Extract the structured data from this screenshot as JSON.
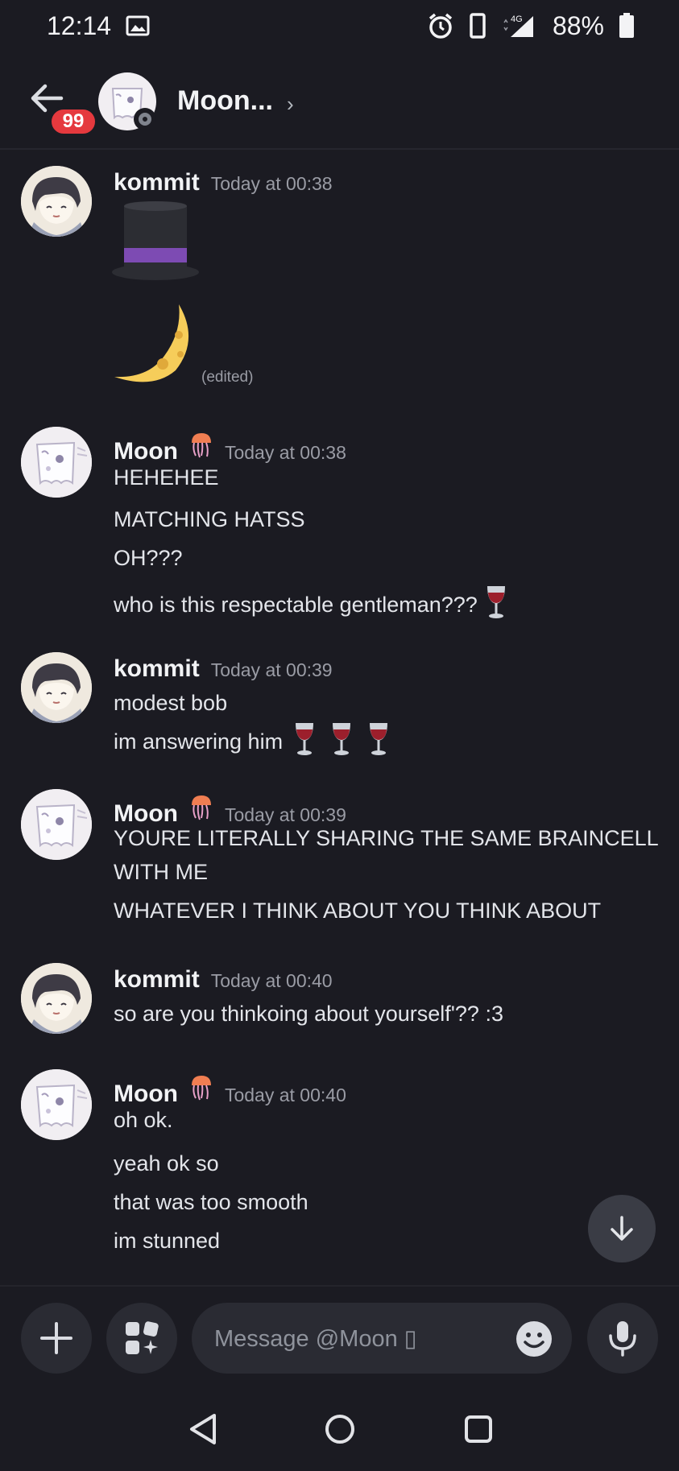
{
  "status_bar": {
    "time": "12:14",
    "network": "4G",
    "battery": "88%"
  },
  "header": {
    "unread_badge": "99",
    "title": "Moon...",
    "chevron": "›"
  },
  "messages": [
    {
      "author": "kommit",
      "time": "Today at 00:38",
      "edited": "(edited)",
      "icons": [
        "top-hat-emoji",
        "crescent-moon-emoji"
      ]
    },
    {
      "author": "Moon",
      "time": "Today at 00:38",
      "lines": [
        "HEHEHEE",
        "MATCHING HATSS",
        "OH???",
        "who is this respectable gentleman???"
      ]
    },
    {
      "author": "kommit",
      "time": "Today at 00:39",
      "lines": [
        "modest bob",
        "im answering him"
      ]
    },
    {
      "author": "Moon",
      "time": "Today at 00:39",
      "lines": [
        "YOURE LITERALLY SHARING THE SAME BRAINCELL",
        "WITH ME",
        "WHATEVER I THINK ABOUT YOU THINK ABOUT"
      ]
    },
    {
      "author": "kommit",
      "time": "Today at 00:40",
      "lines": [
        "so are you thinkoing about yourself'?? :3"
      ]
    },
    {
      "author": "Moon",
      "time": "Today at 00:40",
      "lines": [
        "oh ok.",
        "yeah ok so",
        "that was too smooth",
        "im stunned"
      ]
    }
  ],
  "composer": {
    "placeholder": "Message @Moon ▯"
  },
  "colors": {
    "background": "#1b1b22",
    "badge": "#e5393e",
    "input_bg": "#2a2b33"
  }
}
